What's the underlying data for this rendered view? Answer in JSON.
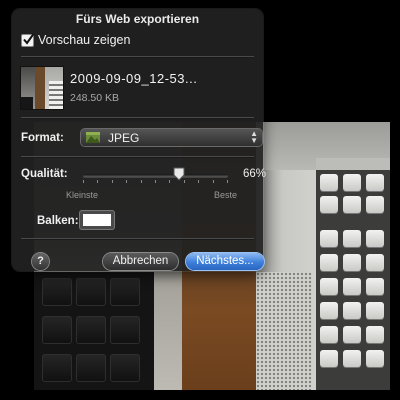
{
  "dialog": {
    "title": "Fürs Web exportieren",
    "preview_label": "Vorschau zeigen",
    "preview_checked": true
  },
  "file": {
    "name": "2009-09-09_12-53...",
    "size": "248.50 KB"
  },
  "format": {
    "label": "Format:",
    "selected": "JPEG",
    "icon": "image-file-icon"
  },
  "quality": {
    "label": "Qualität:",
    "value_text": "66%",
    "value": 0.66,
    "min_label": "Kleinste",
    "max_label": "Beste",
    "ticks": 11
  },
  "border": {
    "label": "Balken:",
    "color": "#ffffff"
  },
  "buttons": {
    "help": "?",
    "cancel": "Abbrechen",
    "next": "Nächstes..."
  },
  "colors": {
    "accent": "#3d7fdb",
    "panel": "#222222"
  }
}
